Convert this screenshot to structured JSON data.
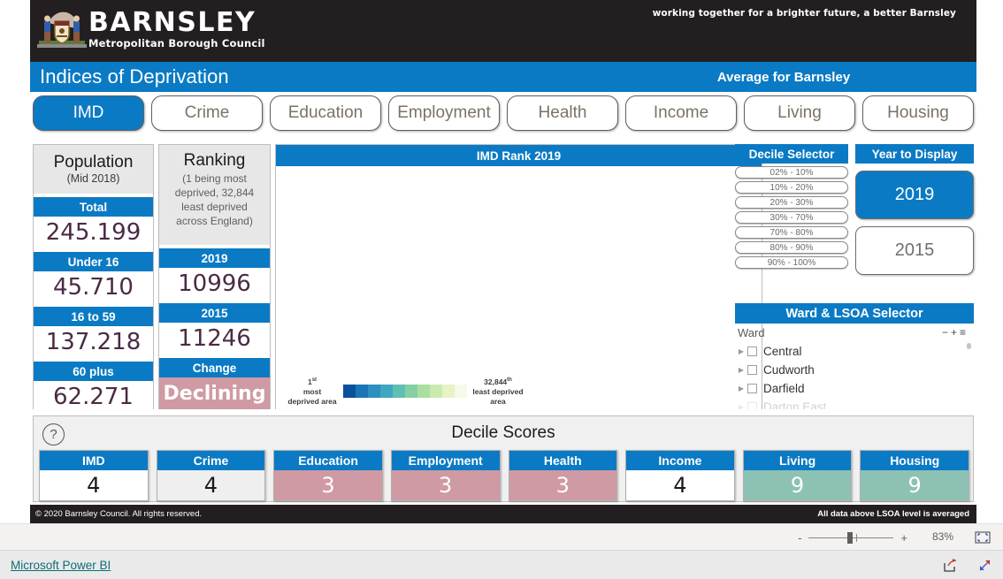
{
  "brand": {
    "name": "BARNSLEY",
    "subtitle": "Metropolitan Borough Council",
    "tagline": "working together for a brighter future, a better Barnsley",
    "crest_icon": "barnsley-coat-of-arms-icon"
  },
  "title_bar": {
    "title": "Indices of Deprivation",
    "subtitle": "Average for Barnsley",
    "accent_color": "#0b7ac4"
  },
  "tabs": [
    {
      "label": "IMD",
      "selected": true
    },
    {
      "label": "Crime",
      "selected": false
    },
    {
      "label": "Education",
      "selected": false
    },
    {
      "label": "Employment",
      "selected": false
    },
    {
      "label": "Health",
      "selected": false
    },
    {
      "label": "Income",
      "selected": false
    },
    {
      "label": "Living",
      "selected": false
    },
    {
      "label": "Housing",
      "selected": false
    }
  ],
  "population": {
    "title": "Population",
    "subtitle": "(Mid 2018)",
    "rows": [
      {
        "label": "Total",
        "value": "245.199"
      },
      {
        "label": "Under 16",
        "value": "45.710"
      },
      {
        "label": "16 to 59",
        "value": "137.218"
      },
      {
        "label": "60 plus",
        "value": "62.271"
      }
    ]
  },
  "ranking": {
    "title": "Ranking",
    "subtitle": "(1 being most deprived, 32,844 least deprived across England)",
    "rows": [
      {
        "label": "2019",
        "value": "10996",
        "style": "plain"
      },
      {
        "label": "2015",
        "value": "11246",
        "style": "plain"
      },
      {
        "label": "Change",
        "value": "Declining",
        "style": "bad"
      }
    ]
  },
  "map_visual": {
    "title": "IMD Rank 2019",
    "legend_low_rank": "1",
    "legend_low_suffix": "st",
    "legend_low_text": "most deprived area",
    "legend_high_rank": "32,844",
    "legend_high_suffix": "th",
    "legend_high_text": "least deprived area",
    "legend_colors": [
      "#08519c",
      "#1b76b8",
      "#2e8fc0",
      "#3fa7bf",
      "#5fbfb2",
      "#86cfa4",
      "#aadfa0",
      "#cceaae",
      "#e6f3c4",
      "#f5faea"
    ]
  },
  "decile_selector": {
    "title": "Decile Selector",
    "options": [
      "02% - 10%",
      "10% - 20%",
      "20% - 30%",
      "30% - 70%",
      "70% - 80%",
      "80% - 90%",
      "90% - 100%"
    ]
  },
  "year_selector": {
    "title": "Year to Display",
    "options": [
      {
        "label": "2019",
        "selected": true
      },
      {
        "label": "2015",
        "selected": false
      }
    ]
  },
  "ward_selector": {
    "title": "Ward & LSOA Selector",
    "column_header": "Ward",
    "tools": [
      "collapse-all-icon",
      "expand-all-icon",
      "menu-icon"
    ],
    "items": [
      {
        "label": "Central",
        "checked": false
      },
      {
        "label": "Cudworth",
        "checked": false
      },
      {
        "label": "Darfield",
        "checked": false
      },
      {
        "label": "Darton East",
        "checked": false
      }
    ]
  },
  "decile_scores": {
    "title": "Decile Scores",
    "help_icon": "question-mark-icon",
    "items": [
      {
        "label": "IMD",
        "value": "4",
        "style": "white"
      },
      {
        "label": "Crime",
        "value": "4",
        "style": "grey"
      },
      {
        "label": "Education",
        "value": "3",
        "style": "rose"
      },
      {
        "label": "Employment",
        "value": "3",
        "style": "rose"
      },
      {
        "label": "Health",
        "value": "3",
        "style": "rose"
      },
      {
        "label": "Income",
        "value": "4",
        "style": "white"
      },
      {
        "label": "Living",
        "value": "9",
        "style": "teal"
      },
      {
        "label": "Housing",
        "value": "9",
        "style": "teal"
      }
    ],
    "rose_color": "#cf9aa3",
    "teal_color": "#8cc1b4"
  },
  "report_footer": {
    "copyright": "© 2020 Barnsley Council. All rights reserved.",
    "note": "All data above LSOA level is averaged"
  },
  "powerbi": {
    "zoom_out_label": "-",
    "zoom_in_label": "+",
    "zoom_level": "83%",
    "fit_icon": "fit-to-page-icon",
    "link_label": "Microsoft Power BI",
    "share_icon": "share-icon",
    "fullscreen_icon": "fullscreen-icon"
  }
}
